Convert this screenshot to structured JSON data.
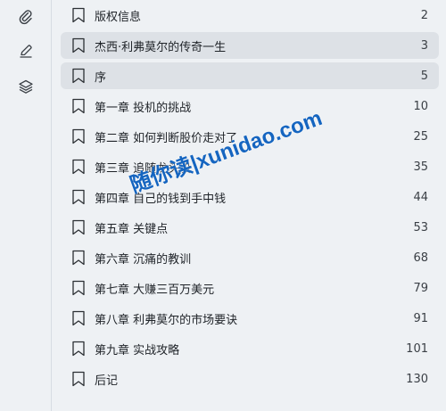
{
  "toolbar": {
    "icons": [
      "attachment-icon",
      "pen-icon",
      "layers-icon"
    ]
  },
  "toc": {
    "entries": [
      {
        "title": "版权信息",
        "page": "2",
        "highlighted": false
      },
      {
        "title": "杰西·利弗莫尔的传奇一生",
        "page": "3",
        "highlighted": true
      },
      {
        "title": "序",
        "page": "5",
        "highlighted": true
      },
      {
        "title": "第一章 投机的挑战",
        "page": "10",
        "highlighted": false
      },
      {
        "title": "第二章 如何判断股价走对了",
        "page": "25",
        "highlighted": false
      },
      {
        "title": "第三章 追随龙头股",
        "page": "35",
        "highlighted": false
      },
      {
        "title": "第四章 自己的钱到手中钱",
        "page": "44",
        "highlighted": false
      },
      {
        "title": "第五章 关键点",
        "page": "53",
        "highlighted": false
      },
      {
        "title": "第六章 沉痛的教训",
        "page": "68",
        "highlighted": false
      },
      {
        "title": "第七章 大赚三百万美元",
        "page": "79",
        "highlighted": false
      },
      {
        "title": "第八章 利弗莫尔的市场要诀",
        "page": "91",
        "highlighted": false
      },
      {
        "title": "第九章 实战攻略",
        "page": "101",
        "highlighted": false
      },
      {
        "title": "后记",
        "page": "130",
        "highlighted": false
      }
    ]
  },
  "watermark": {
    "text": "随你读|xunidao.com",
    "color": "#1565c0"
  },
  "colors": {
    "background": "#eef1f4",
    "highlight": "#dde1e6",
    "text": "#1f2328"
  }
}
